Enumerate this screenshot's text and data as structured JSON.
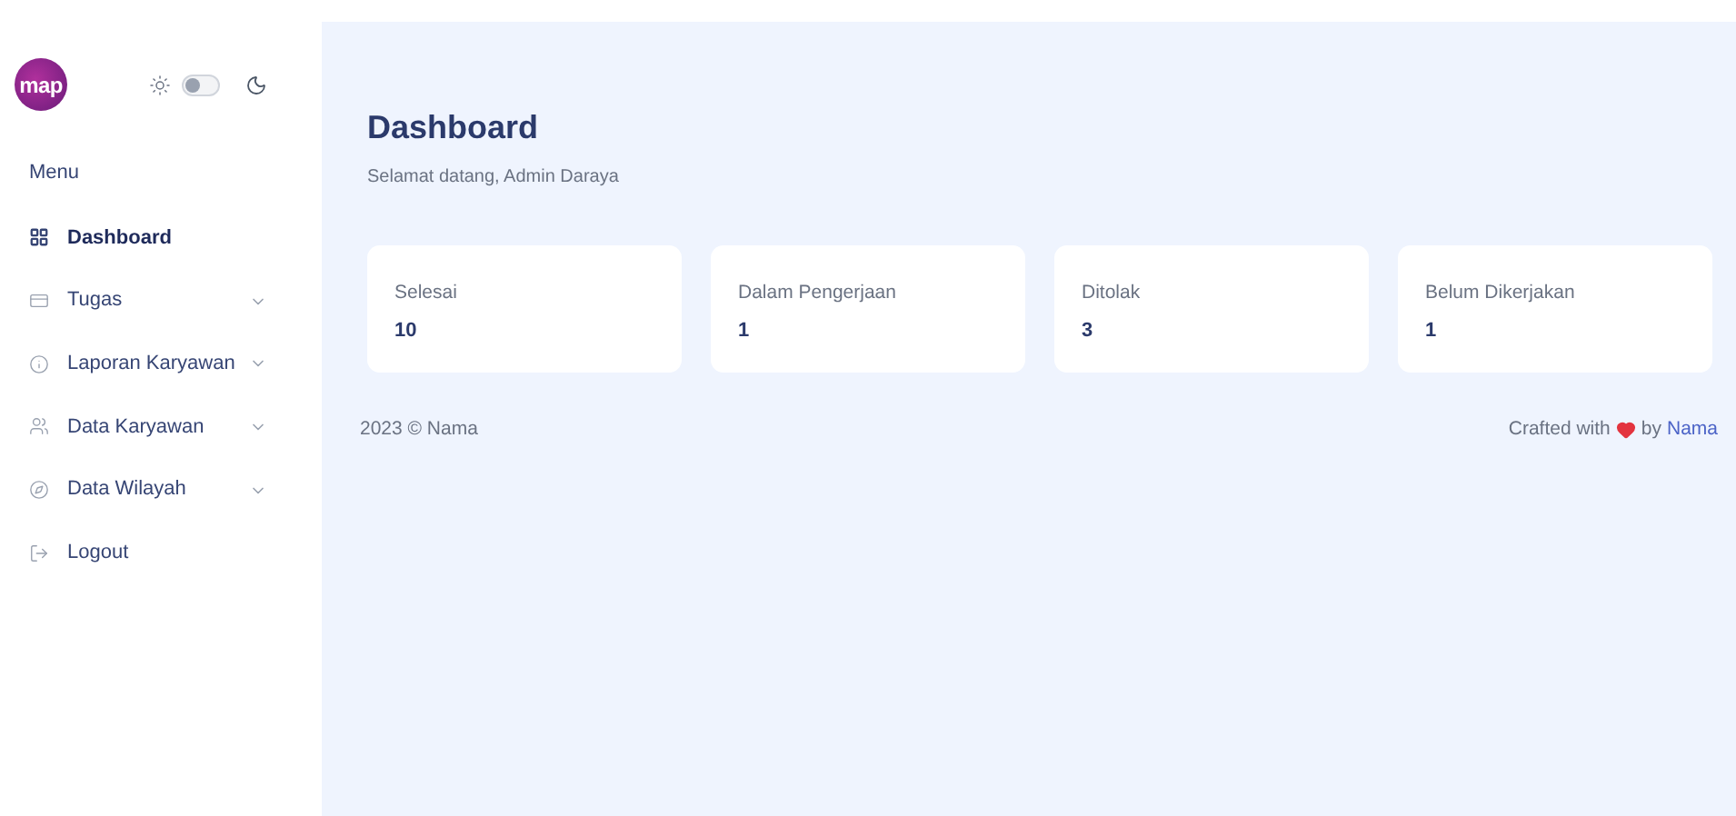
{
  "logo": "map",
  "theme_toggle": {
    "on": false
  },
  "menu_title": "Menu",
  "menu": [
    {
      "label": "Dashboard",
      "expandable": false,
      "selected": true
    },
    {
      "label": "Tugas",
      "expandable": true,
      "selected": false
    },
    {
      "label": "Laporan Karyawan",
      "expandable": true,
      "selected": false
    },
    {
      "label": "Data Karyawan",
      "expandable": true,
      "selected": false
    },
    {
      "label": "Data Wilayah",
      "expandable": true,
      "selected": false
    },
    {
      "label": "Logout",
      "expandable": false,
      "selected": false
    }
  ],
  "page_title": "Dashboard",
  "greeting": "Selamat datang, Admin Daraya",
  "stats": [
    {
      "label": "Selesai",
      "value": "10"
    },
    {
      "label": "Dalam Pengerjaan",
      "value": "1"
    },
    {
      "label": "Ditolak",
      "value": "3"
    },
    {
      "label": "Belum Dikerjakan",
      "value": "1"
    }
  ],
  "footer": {
    "copyright": "2023 © Nama",
    "crafted": "Crafted with",
    "by": "by",
    "author": "Nama"
  }
}
